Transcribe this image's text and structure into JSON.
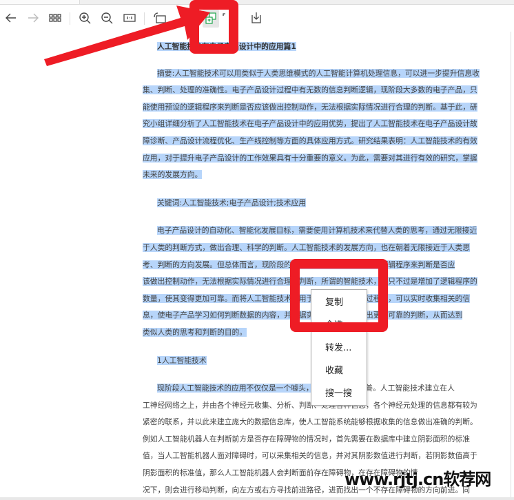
{
  "toolbar": {
    "buttons": [
      {
        "icon": "arrow-left-icon"
      },
      {
        "icon": "arrow-right-icon"
      },
      {
        "icon": "grid-icon"
      },
      {
        "icon": "zoom-in-icon"
      },
      {
        "icon": "zoom-out-icon"
      },
      {
        "icon": "actual-size-icon"
      },
      {
        "icon": "rotate-icon"
      },
      {
        "icon": "translate-icon",
        "active": true,
        "color": "#1aa34a"
      },
      {
        "icon": "fullscreen-icon"
      },
      {
        "icon": "download-icon"
      }
    ]
  },
  "document": {
    "title": "人工智能技术在电子产品设计中的应用篇1",
    "abstract": [
      "摘要:人工智能技术可以用类似于人类思维模式的人工智能计算机处理信息，可以进一步提升信息收",
      "集、判断、处理的准确性。电子产品设计过程中有无数的信息判断逻辑，现阶段大多数的电子产品，只",
      "能使用预设的逻辑程序来判断是否应该做出控制动作，无法根据实际情况进行合理的判断。基于此，研",
      "究小组详细分析了人工智能技术在电子产品设计中的应用优势，提出了人工智能技术在电子产品设计故",
      "障诊断、产品设计流程优化、生产线控制等方面的具体应用方式。研究结果表明：人工智能技术的有效",
      "应用，对于提升电子产品设计的工作效果具有十分重要的意义。为此，需要对其进行有效的研究，掌握",
      "未来的发展方向。"
    ],
    "keywords": "关键词:人工智能技术;电子产品设计;技术应用",
    "para2": [
      "电子产品设计的自动化、智能化发展目标，需要使用计算机技术来代替人类的思考，通过无限接近",
      "于人类的判断方式，做出合理、科学的判断。人工智能技术的发展方向，也在朝着无限接近于人类思",
      "考、判断的方向发展。但总体而言，现阶段的电子产品仍只能使用预设的逻辑程序来判断是否应",
      "该做出控制动作，无法根据实际情况进行合理的判断，所谓的智能技术，也只不过是增加了逻辑程序的",
      "数量，使其变得更加可靠。而将人工智能技术应用于电子产品设计的过程中，可以实时收集相关的信",
      "息，使电子产品学习如何判断数据的内容，并根据实际情况调整，做出更加可靠的判断，从而达到",
      "类似人类的思考和判断的目的。"
    ],
    "heading1": "1人工智能技术",
    "para3_selected": "现阶段人工智能技术的应用不仅仅是一个噱头，其技术正日益",
    "para3_rest": "完善。人工智能技术建立在人",
    "para3": [
      "工神经网络之上，并由各个神经元收集、分析、判断、处理各种信息，各个神经元处理的信息都有较为",
      "紧密的联系，并以此来建立庞大的数据信息库，使人工智能系统能够根据收集的信息做出准确的判断。",
      "例如人工智能机器人在判断前方是否存在障碍物的情况时，首先需要在数据库中建立阴影面积的标准",
      "值，当人工智能机器人面对障碍时，可以采集相关的信息，并对其阴影数值进行判断，若阴影数值高于",
      "阴影面积的标准值，那么人工智能机器人会判断面前存在障碍物，在存在障碍物的情",
      "况下，则会进行移动判断，向左方或右方寻找前进路径，进而找出一个不存在障碍物的方向前进。同"
    ]
  },
  "context_menu": {
    "items": [
      "复制",
      "全选",
      "转发...",
      "收藏",
      "搜一搜"
    ]
  },
  "watermark": "www.rjtj.cn软荐网",
  "colors": {
    "selection": "#b7d5fa",
    "annotation": "#ee1c25",
    "accent": "#1aa34a"
  }
}
